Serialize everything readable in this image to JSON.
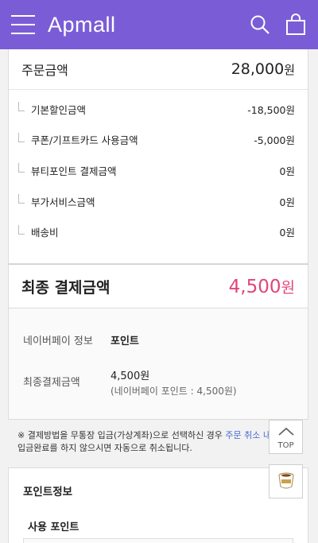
{
  "header": {
    "logo": "Apmall",
    "menu_icon": "hamburger-menu-icon",
    "search_icon": "search-icon",
    "bag_icon": "shopping-bag-icon",
    "bg_color": "#7a5dd6"
  },
  "order_total": {
    "label": "주문금액",
    "value": "28,000",
    "unit": "원"
  },
  "discounts": [
    {
      "label": "기본할인금액",
      "value": "-18,500원"
    },
    {
      "label": "쿠폰/기프트카드 사용금액",
      "value": "-5,000원"
    },
    {
      "label": "뷰티포인트 결제금액",
      "value": "0원"
    },
    {
      "label": "부가서비스금액",
      "value": "0원"
    },
    {
      "label": "배송비",
      "value": "0원"
    }
  ],
  "final_total": {
    "label": "최종 결제금액",
    "value": "4,500",
    "unit": "원",
    "color": "#e0457b"
  },
  "payment_info": {
    "naverpay_label": "네이버페이 정보",
    "naverpay_value": "포인트",
    "final_label": "최종결제금액",
    "final_amount": "4,500원",
    "final_detail": "(네이버페이 포인트 : 4,500원)"
  },
  "notice": {
    "text_before": "※ 결제방법을 무통장 입금(가상계좌)으로 선택하신 경우 ",
    "link_text": "주문 취소 내에",
    "text_after": " 입금완료를 하지 않으시면 자동으로 취소됩니다."
  },
  "points": {
    "title": "포인트정보",
    "use_label": "사용 포인트"
  },
  "fab": {
    "top_label": "TOP",
    "cup_icon": "coffee-cup-icon"
  }
}
